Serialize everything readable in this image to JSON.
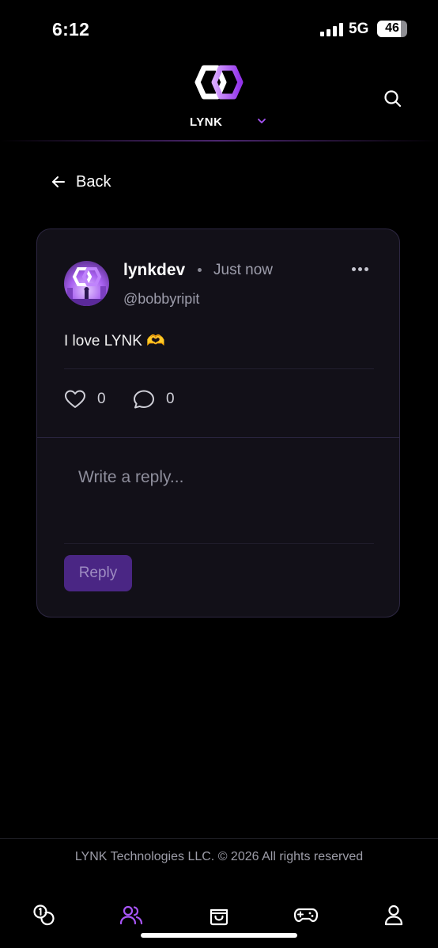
{
  "status_bar": {
    "time": "6:12",
    "network": "5G",
    "battery": "46"
  },
  "header": {
    "brand": "LYNK"
  },
  "nav": {
    "back_label": "Back"
  },
  "post": {
    "username": "lynkdev",
    "time": "Just now",
    "handle": "@bobbyripit",
    "text": "I love LYNK 🫶",
    "likes": "0",
    "comments": "0"
  },
  "reply": {
    "placeholder": "Write a reply...",
    "button_label": "Reply"
  },
  "footer": {
    "copyright": "LYNK Technologies LLC. © 2026 All rights reserved"
  },
  "tabs": [
    {
      "icon": "coins-icon",
      "active": false
    },
    {
      "icon": "community-icon",
      "active": true
    },
    {
      "icon": "shopping-bag-icon",
      "active": false
    },
    {
      "icon": "gamepad-icon",
      "active": false
    },
    {
      "icon": "profile-icon",
      "active": false
    }
  ],
  "colors": {
    "accent": "#a855f7",
    "card_bg": "#121018",
    "card_border": "#2d2742",
    "button_bg": "#4a2684"
  }
}
